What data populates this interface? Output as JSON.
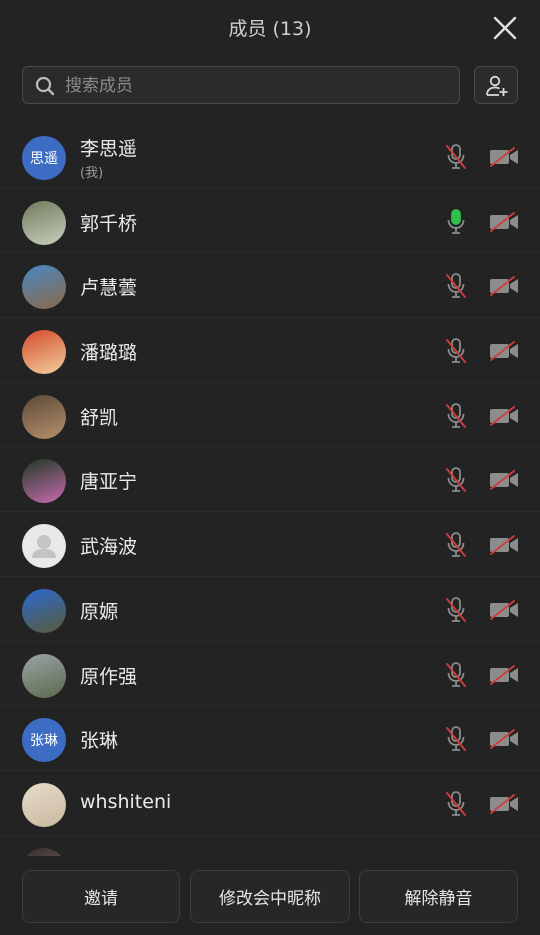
{
  "header": {
    "title": "成员 (13)"
  },
  "search": {
    "placeholder": "搜索成员"
  },
  "members": [
    {
      "name": "李思遥",
      "sub": "(我)",
      "avatar_type": "text",
      "avatar_text": "思遥",
      "mic": "muted"
    },
    {
      "name": "郭千桥",
      "avatar_type": "image",
      "avatar_colors": [
        "#6f7a5a",
        "#c8d0c0"
      ],
      "mic": "active"
    },
    {
      "name": "卢慧蕓",
      "avatar_type": "image",
      "avatar_colors": [
        "#4a86c2",
        "#8a6a4a"
      ],
      "mic": "muted"
    },
    {
      "name": "潘璐璐",
      "avatar_type": "image",
      "avatar_colors": [
        "#d24a2a",
        "#f3d0a0"
      ],
      "mic": "muted"
    },
    {
      "name": "舒凯",
      "avatar_type": "image",
      "avatar_colors": [
        "#5a4a3a",
        "#b8906a"
      ],
      "mic": "muted"
    },
    {
      "name": "唐亚宁",
      "avatar_type": "image",
      "avatar_colors": [
        "#1f3a22",
        "#c86ab0"
      ],
      "mic": "muted"
    },
    {
      "name": "武海波",
      "avatar_type": "blank",
      "mic": "muted"
    },
    {
      "name": "原嫄",
      "avatar_type": "image",
      "avatar_colors": [
        "#2a6ad0",
        "#5a5a3a"
      ],
      "mic": "muted"
    },
    {
      "name": "原作强",
      "avatar_type": "image",
      "avatar_colors": [
        "#9aa4a8",
        "#5a6a4a"
      ],
      "mic": "muted"
    },
    {
      "name": "张琳",
      "avatar_type": "text",
      "avatar_text": "张琳",
      "mic": "muted"
    },
    {
      "name": "whshiteni",
      "avatar_type": "image",
      "avatar_colors": [
        "#e8dcc8",
        "#c8b8a0"
      ],
      "mic": "muted"
    },
    {
      "name": "",
      "avatar_type": "image",
      "avatar_colors": [
        "#3a3030",
        "#806a60"
      ],
      "mic": "muted"
    }
  ],
  "footer": {
    "invite_label": "邀请",
    "rename_label": "修改会中昵称",
    "unmute_label": "解除静音"
  },
  "colors": {
    "background": "#232323",
    "text_avatar": "#3c6cc4",
    "mic_active": "#2ec04a",
    "mute_slash": "#d23c3c"
  },
  "icons": {
    "close": "close-icon",
    "search": "search-icon",
    "add_user": "add-user-icon",
    "mic_muted": "mic-muted-icon",
    "mic_active": "mic-active-icon",
    "camera_off": "camera-off-icon"
  }
}
